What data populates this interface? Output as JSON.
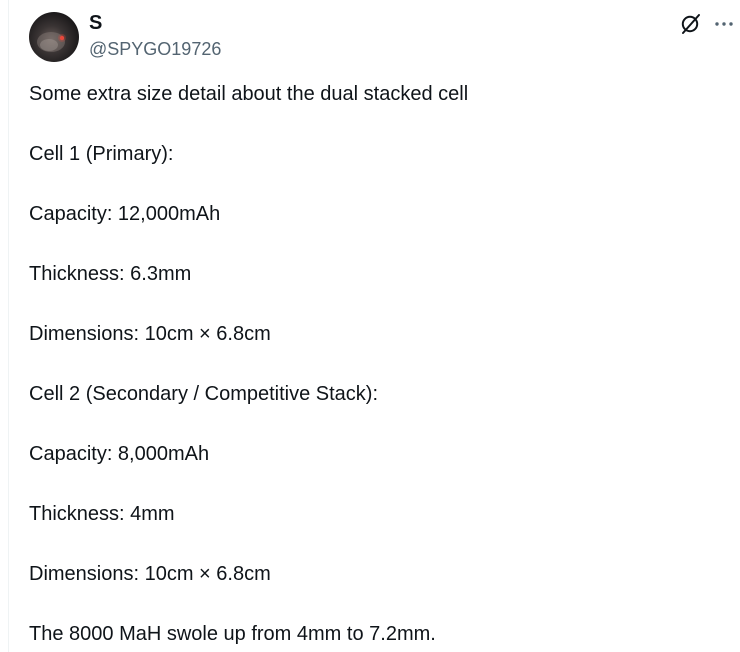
{
  "author": {
    "display_name": "S",
    "handle": "@SPYGO19726",
    "avatar_icon": "avatar-photo"
  },
  "actions": {
    "grok_icon": "grok-icon",
    "more_icon": "more-icon"
  },
  "tweet": {
    "lines": [
      "Some extra size detail about the dual stacked cell",
      "Cell 1 (Primary):",
      "Capacity: 12,000mAh",
      "Thickness: 6.3mm",
      "Dimensions: 10cm × 6.8cm",
      "Cell 2 (Secondary / Competitive Stack):",
      "Capacity: 8,000mAh",
      "Thickness: 4mm",
      "Dimensions: 10cm × 6.8cm",
      "The 8000 MaH swole up from 4mm to 7.2mm."
    ]
  },
  "colors": {
    "text": "#0f1419",
    "secondary_text": "#536471",
    "divider": "#eff3f4"
  }
}
